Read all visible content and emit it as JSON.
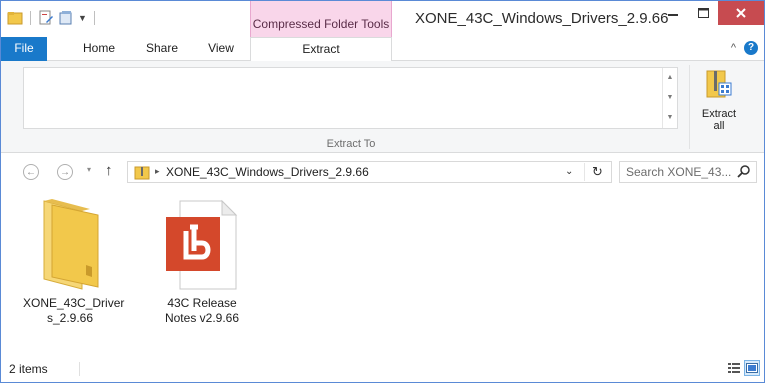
{
  "window": {
    "title": "XONE_43C_Windows_Drivers_2.9.66",
    "contextual_tab_group": "Compressed Folder Tools",
    "caption": {
      "minimize": "–",
      "maximize": "□",
      "close": "✕"
    }
  },
  "ribbon": {
    "tabs": {
      "file": "File",
      "home": "Home",
      "share": "Share",
      "view": "View",
      "extract": "Extract"
    },
    "collapse_glyph": "^",
    "help_glyph": "?",
    "extract_to_group": "Extract To",
    "extract_all_line1": "Extract",
    "extract_all_line2": "all"
  },
  "navigation": {
    "back": "←",
    "forward": "→",
    "recent": "▾",
    "up": "↑",
    "crumb_separator": "▸",
    "breadcrumb": "XONE_43C_Windows_Drivers_2.9.66",
    "address_dropdown": "⌄",
    "refresh": "↻",
    "search_placeholder": "Search XONE_43..."
  },
  "files": [
    {
      "name_line1": "XONE_43C_Driver",
      "name_line2": "s_2.9.66",
      "icon": "folder-icon"
    },
    {
      "name_line1": "43C Release",
      "name_line2": "Notes v2.9.66",
      "icon": "pdf-document-icon"
    }
  ],
  "status": {
    "item_count": "2 items"
  },
  "colors": {
    "file_tab": "#1979ca",
    "contextual_tab": "#f9d6ea",
    "close_button": "#c74b50",
    "folder": "#f2c84b",
    "pdf_red": "#d4482b"
  }
}
